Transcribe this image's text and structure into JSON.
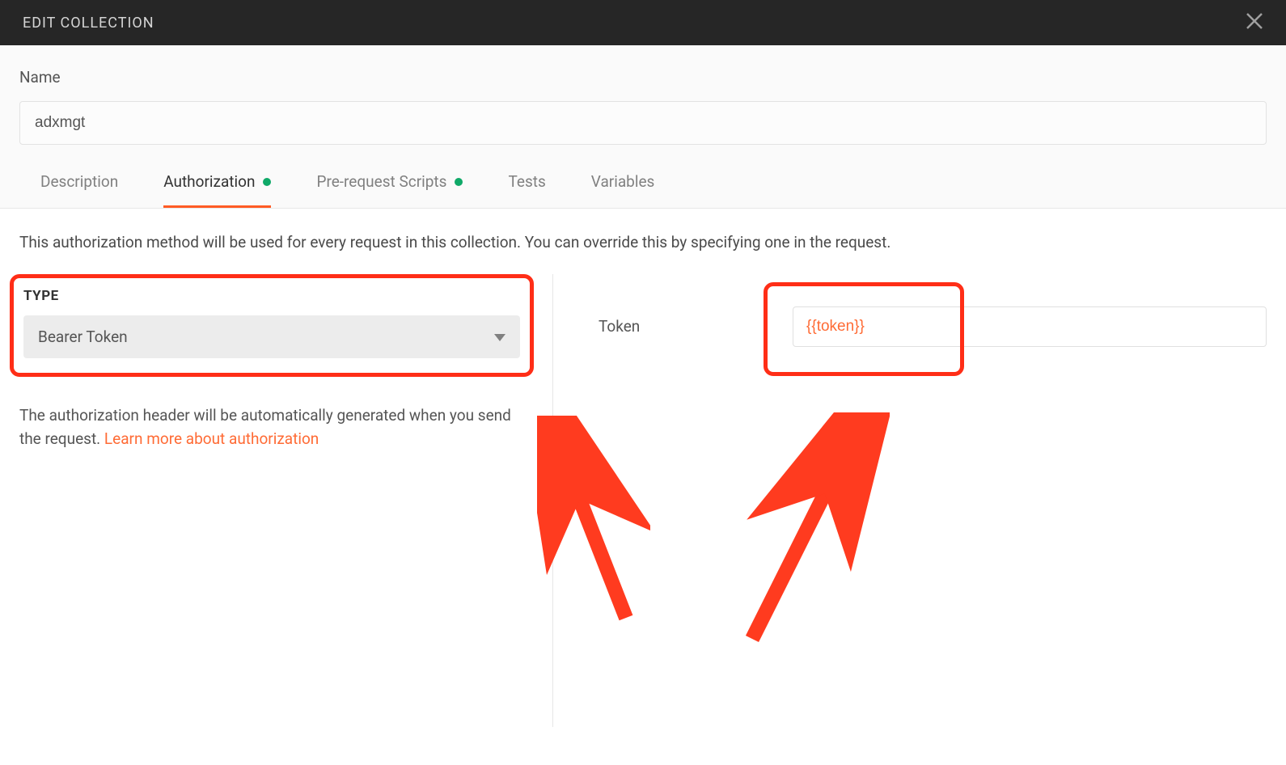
{
  "header": {
    "title": "EDIT COLLECTION"
  },
  "name": {
    "label": "Name",
    "value": "adxmgt"
  },
  "tabs": [
    {
      "label": "Description",
      "active": false,
      "dot": false
    },
    {
      "label": "Authorization",
      "active": true,
      "dot": true
    },
    {
      "label": "Pre-request Scripts",
      "active": false,
      "dot": true
    },
    {
      "label": "Tests",
      "active": false,
      "dot": false
    },
    {
      "label": "Variables",
      "active": false,
      "dot": false
    }
  ],
  "auth": {
    "info": "This authorization method will be used for every request in this collection. You can override this by specifying one in the request.",
    "type_label": "TYPE",
    "type_value": "Bearer Token",
    "help_prefix": "The authorization header will be automatically generated when you send the request. ",
    "learn_more": "Learn more about authorization",
    "token_label": "Token",
    "token_value": "{{token}}"
  }
}
